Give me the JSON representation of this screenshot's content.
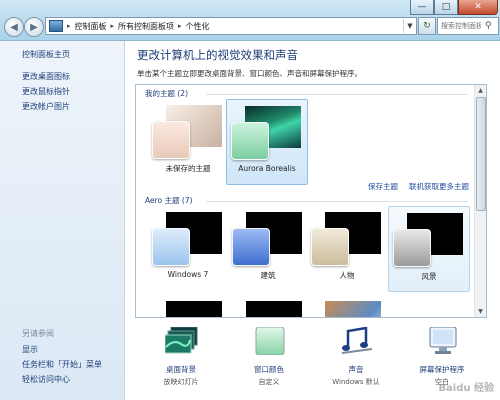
{
  "window": {
    "minimize": "—",
    "maximize": "□",
    "close": "✕"
  },
  "address": {
    "crumbs": [
      "控制面板",
      "所有控制面板项",
      "个性化"
    ],
    "search_placeholder": "搜索控制面板"
  },
  "sidebar": {
    "links": [
      "控制面板主页",
      "更改桌面图标",
      "更改鼠标指针",
      "更改帐户图片"
    ],
    "see_also_title": "另请参阅",
    "see_also": [
      "显示",
      "任务栏和「开始」菜单",
      "轻松访问中心"
    ]
  },
  "main": {
    "title": "更改计算机上的视觉效果和声音",
    "description": "单击某个主题立即更改桌面背景、窗口颜色、声音和屏幕保护程序。"
  },
  "themes": {
    "my_section": "我的主题 (2)",
    "my_items": [
      "未保存的主题",
      "Aurora Borealis"
    ],
    "save_link": "保存主题",
    "online_link": "联机获取更多主题",
    "aero_section": "Aero 主题 (7)",
    "aero_items": [
      "Windows 7",
      "建筑",
      "人物",
      "风景"
    ]
  },
  "bottom": [
    {
      "label": "桌面背景",
      "sub": "放映幻灯片"
    },
    {
      "label": "窗口颜色",
      "sub": "自定义"
    },
    {
      "label": "声音",
      "sub": "Windows 默认"
    },
    {
      "label": "屏幕保护程序",
      "sub": "空白"
    }
  ],
  "watermark": "Baidu 经验",
  "colors": {
    "link": "#1f3e7a",
    "title": "#1c3d7a",
    "selection": "#cfe6f8"
  }
}
